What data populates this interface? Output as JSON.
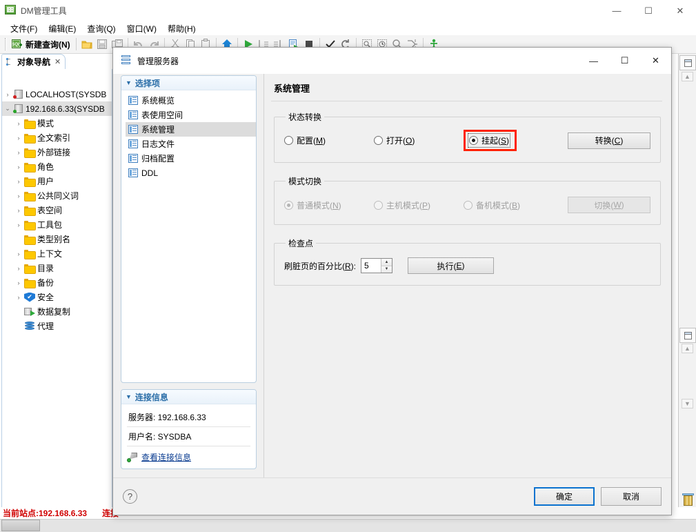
{
  "window": {
    "title": "DM管理工具",
    "icon": "dm-app-icon",
    "controls": {
      "minimize": "—",
      "maximize": "☐",
      "close": "✕"
    }
  },
  "menubar": {
    "items": [
      {
        "label": "文件(F)",
        "name": "menu-file"
      },
      {
        "label": "编辑(E)",
        "name": "menu-edit"
      },
      {
        "label": "查询(Q)",
        "name": "menu-query"
      },
      {
        "label": "窗口(W)",
        "name": "menu-window"
      },
      {
        "label": "帮助(H)",
        "name": "menu-help"
      }
    ]
  },
  "toolbar": {
    "new_query_label": "新建查询(N)"
  },
  "navigator": {
    "tab_label": "对象导航",
    "tab_close": "✕",
    "tree": [
      {
        "label": "LOCALHOST(SYSDB",
        "indent": 0,
        "twist": "›",
        "icon": "server-icon",
        "dot": "#d02020",
        "selected": false
      },
      {
        "label": "192.168.6.33(SYSDB",
        "indent": 0,
        "twist": "⌄",
        "icon": "server-icon",
        "dot": "#27a327",
        "selected": true
      },
      {
        "label": "模式",
        "indent": 1,
        "twist": "›",
        "icon": "folder-icon"
      },
      {
        "label": "全文索引",
        "indent": 1,
        "twist": "›",
        "icon": "folder-icon"
      },
      {
        "label": "外部链接",
        "indent": 1,
        "twist": "›",
        "icon": "folder-icon"
      },
      {
        "label": "角色",
        "indent": 1,
        "twist": "›",
        "icon": "folder-icon"
      },
      {
        "label": "用户",
        "indent": 1,
        "twist": "›",
        "icon": "folder-icon"
      },
      {
        "label": "公共同义词",
        "indent": 1,
        "twist": "›",
        "icon": "folder-icon"
      },
      {
        "label": "表空间",
        "indent": 1,
        "twist": "›",
        "icon": "folder-icon"
      },
      {
        "label": "工具包",
        "indent": 1,
        "twist": "›",
        "icon": "folder-icon"
      },
      {
        "label": "类型别名",
        "indent": 1,
        "twist": "",
        "icon": "folder-icon"
      },
      {
        "label": "上下文",
        "indent": 1,
        "twist": "›",
        "icon": "folder-icon"
      },
      {
        "label": "目录",
        "indent": 1,
        "twist": "›",
        "icon": "folder-icon"
      },
      {
        "label": "备份",
        "indent": 1,
        "twist": "›",
        "icon": "folder-icon"
      },
      {
        "label": "安全",
        "indent": 1,
        "twist": "›",
        "icon": "shield-icon"
      },
      {
        "label": "数据复制",
        "indent": 1,
        "twist": "",
        "icon": "replication-icon"
      },
      {
        "label": "代理",
        "indent": 1,
        "twist": "",
        "icon": "agent-icon"
      }
    ]
  },
  "dialog": {
    "title": "管理服务器",
    "icon": "server-manage-icon",
    "controls": {
      "minimize": "—",
      "maximize": "☐",
      "close": "✕"
    },
    "options_panel": {
      "header": "选择项",
      "caret": "▼",
      "items": [
        {
          "label": "系统概览",
          "selected": false
        },
        {
          "label": "表使用空间",
          "selected": false
        },
        {
          "label": "系统管理",
          "selected": true
        },
        {
          "label": "日志文件",
          "selected": false
        },
        {
          "label": "归档配置",
          "selected": false
        },
        {
          "label": "DDL",
          "selected": false
        }
      ]
    },
    "connection_panel": {
      "header": "连接信息",
      "caret": "▼",
      "server_row": "服务器: 192.168.6.33",
      "user_row": "用户名: SYSDBA",
      "link_label": "查看连接信息"
    },
    "pane_title": "系统管理",
    "groups": [
      {
        "name": "state-transition",
        "legend": "状态转换",
        "disabled": false,
        "radios": [
          {
            "label_before": "配置(",
            "mnemonic": "M",
            "label_after": ")",
            "checked": false,
            "disabled": false,
            "highlighted": false
          },
          {
            "label_before": "打开(",
            "mnemonic": "O",
            "label_after": ")",
            "checked": false,
            "disabled": false,
            "highlighted": false
          },
          {
            "label_before": "挂起(",
            "mnemonic": "S",
            "label_after": ")",
            "checked": true,
            "disabled": false,
            "highlighted": true
          }
        ],
        "button": {
          "label_before": "转换(",
          "mnemonic": "C",
          "label_after": ")",
          "disabled": false
        }
      },
      {
        "name": "mode-switch",
        "legend": "模式切换",
        "disabled": true,
        "radios": [
          {
            "label_before": "普通模式(",
            "mnemonic": "N",
            "label_after": ")",
            "checked": true,
            "disabled": true,
            "highlighted": false
          },
          {
            "label_before": "主机模式(",
            "mnemonic": "P",
            "label_after": ")",
            "checked": false,
            "disabled": true,
            "highlighted": false
          },
          {
            "label_before": "备机模式(",
            "mnemonic": "B",
            "label_after": ")",
            "checked": false,
            "disabled": true,
            "highlighted": false
          }
        ],
        "button": {
          "label_before": "切换(",
          "mnemonic": "W",
          "label_after": ")",
          "disabled": true
        }
      }
    ],
    "checkpoint": {
      "legend": "检查点",
      "spin_label_before": "刷脏页的百分比(",
      "spin_label_mnemonic": "R",
      "spin_label_after": "):",
      "spin_value": "5",
      "spin_up": "▲",
      "spin_down": "▼",
      "button": {
        "label_before": "执行(",
        "mnemonic": "E",
        "label_after": ")"
      }
    },
    "footer": {
      "help": "?",
      "ok": "确定",
      "cancel": "取消"
    }
  },
  "statusbar": {
    "site": "当前站点:192.168.6.33",
    "connection": "连接"
  },
  "colors": {
    "highlight_red": "#ff2200",
    "status_red": "#d00000",
    "accent_blue": "#2b6ea8",
    "focus_blue": "#0a72cf"
  }
}
